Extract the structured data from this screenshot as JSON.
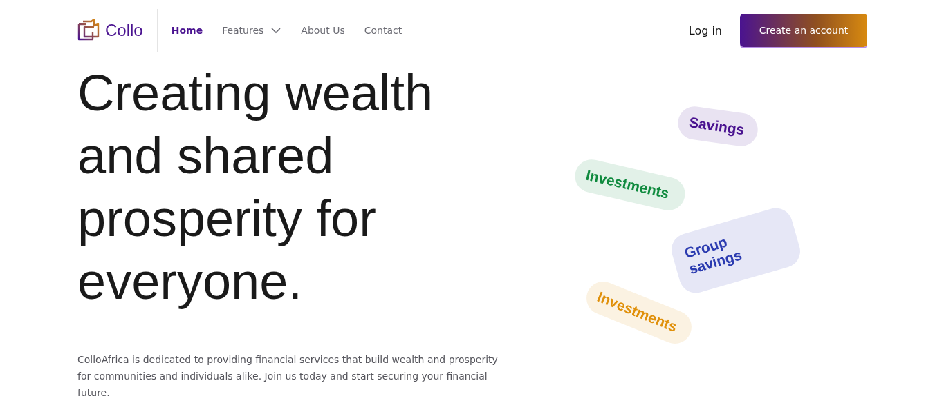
{
  "brand": {
    "name": "Collo"
  },
  "nav": [
    {
      "label": "Home",
      "selected": true,
      "has_menu": false
    },
    {
      "label": "Features",
      "selected": false,
      "has_menu": true
    },
    {
      "label": "About Us",
      "selected": false,
      "has_menu": false
    },
    {
      "label": "Contact",
      "selected": false,
      "has_menu": false
    }
  ],
  "actions": {
    "login": "Log in",
    "signup": "Create an account"
  },
  "hero": {
    "heading": "Creating wealth and shared prosperity for everyone.",
    "body": "ColloAfrica is dedicated to providing financial services that build wealth and prosperity for communities and individuals alike. Join us today and start securing your financial future."
  },
  "tags": [
    {
      "label": "Savings",
      "color": "#4a1390"
    },
    {
      "label": "Investments",
      "color": "#0f8a3e"
    },
    {
      "label": "Group savings",
      "color": "#2b3bb0"
    },
    {
      "label": "Investments",
      "color": "#e0900a"
    }
  ]
}
